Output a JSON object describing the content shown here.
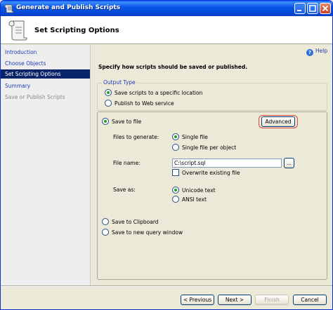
{
  "window": {
    "title": "Generate and Publish Scripts"
  },
  "header": {
    "title": "Set Scripting Options"
  },
  "nav": {
    "items": [
      {
        "label": "Introduction"
      },
      {
        "label": "Choose Objects"
      },
      {
        "label": "Set Scripting Options"
      },
      {
        "label": "Summary"
      },
      {
        "label": "Save or Publish Scripts"
      }
    ]
  },
  "help": {
    "label": "Help"
  },
  "instruction": "Specify how scripts should be saved or published.",
  "output_type": {
    "legend": "Output Type",
    "save_scripts_label": "Save scripts to a specific location",
    "publish_label": "Publish to Web service"
  },
  "save_options": {
    "save_to_file_label": "Save to file",
    "advanced_label": "Advanced",
    "files_to_generate_label": "Files to generate:",
    "single_file_label": "Single file",
    "single_file_per_object_label": "Single file per object",
    "file_name_label": "File name:",
    "file_name_value": "C:\\script.sql",
    "browse_label": "...",
    "overwrite_label": "Overwrite existing file",
    "save_as_label": "Save as:",
    "unicode_label": "Unicode text",
    "ansi_label": "ANSI text",
    "clipboard_label": "Save to Clipboard",
    "new_query_label": "Save to new query window"
  },
  "footer": {
    "previous_label": "< Previous",
    "next_label": "Next >",
    "finish_label": "Finish",
    "cancel_label": "Cancel"
  },
  "colors": {
    "title_bar": "#0a5ff5",
    "selected_nav": "#0a246a",
    "link_blue": "#1c3cb8",
    "highlight_red": "#d9453b"
  }
}
